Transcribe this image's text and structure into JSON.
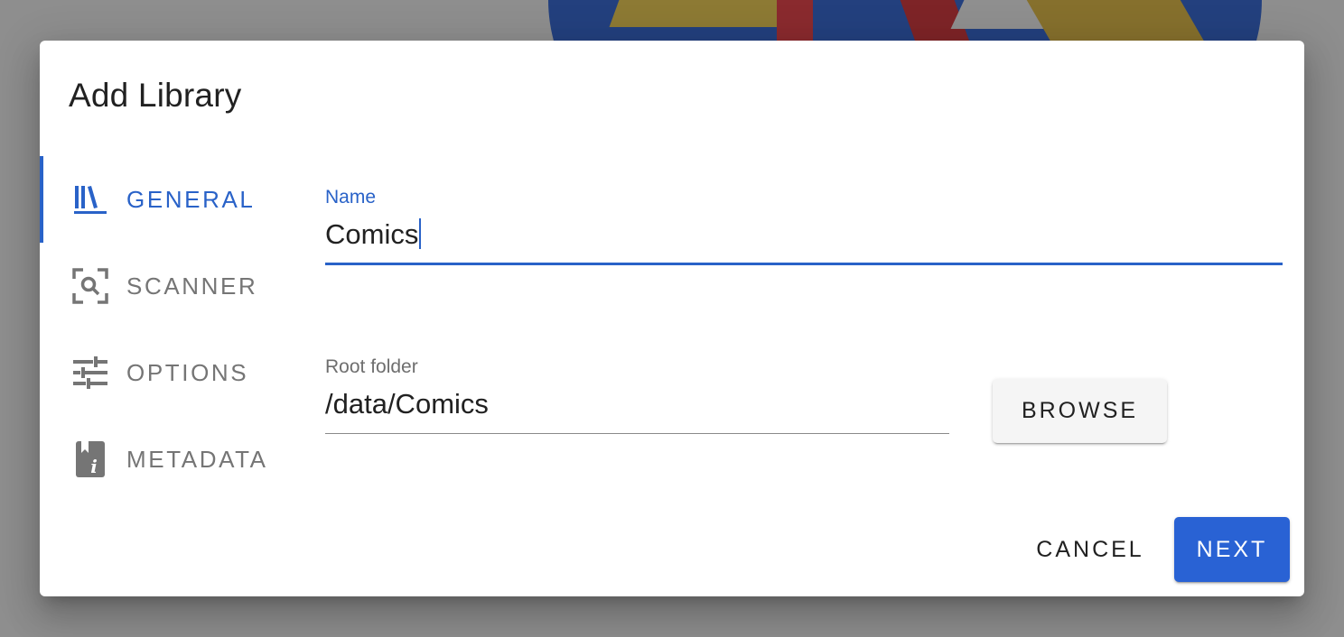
{
  "dialog": {
    "title": "Add Library"
  },
  "tabs": [
    {
      "label": "GENERAL",
      "icon": "bookshelf-icon",
      "active": true
    },
    {
      "label": "SCANNER",
      "icon": "scan-search-icon",
      "active": false
    },
    {
      "label": "OPTIONS",
      "icon": "tune-sliders-icon",
      "active": false
    },
    {
      "label": "METADATA",
      "icon": "book-info-icon",
      "active": false
    }
  ],
  "form": {
    "name": {
      "label": "Name",
      "value": "Comics"
    },
    "root_folder": {
      "label": "Root folder",
      "value": "/data/Comics"
    },
    "browse_label": "BROWSE"
  },
  "actions": {
    "cancel_label": "CANCEL",
    "next_label": "NEXT"
  },
  "colors": {
    "accent": "#2962c8",
    "primary_button": "#2962d4",
    "inactive_text": "#757575"
  }
}
